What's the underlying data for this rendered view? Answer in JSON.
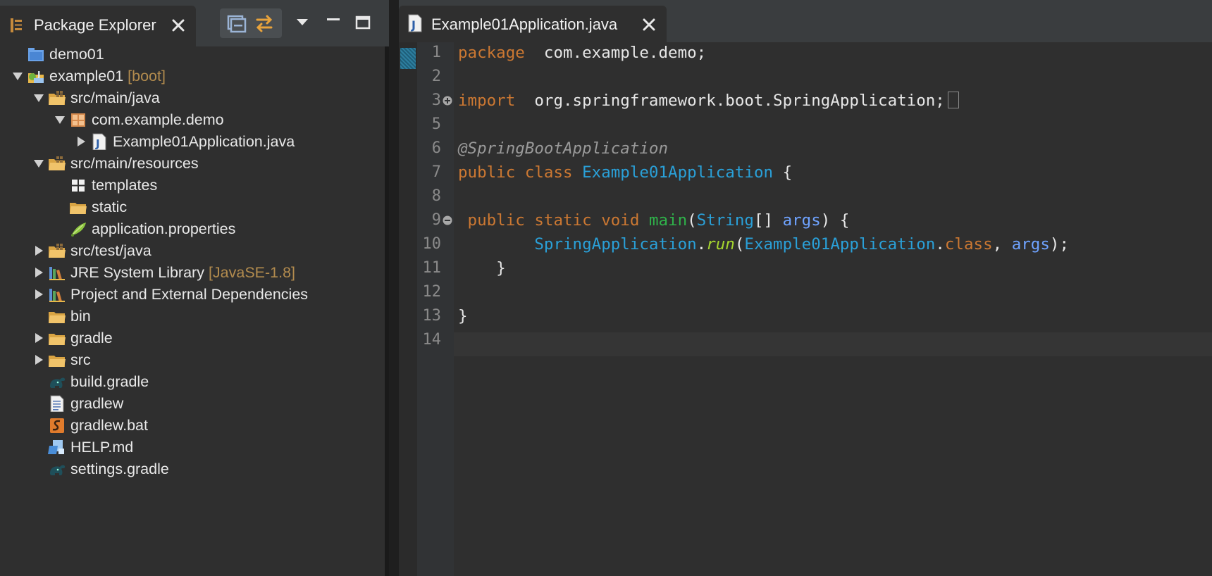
{
  "explorer": {
    "title": "Package Explorer",
    "toolbar": {
      "collapse_all": "collapse-all-icon",
      "link_editor": "link-with-editor-icon",
      "view_menu": "view-menu-icon",
      "minimize": "minimize-icon",
      "maximize": "maximize-icon"
    },
    "tree": [
      {
        "label": "demo01",
        "decoration": "",
        "icon": "project-closed-icon",
        "twisty": "none",
        "level": 0
      },
      {
        "label": "example01",
        "decoration": "[boot]",
        "icon": "spring-project-icon",
        "twisty": "expanded",
        "level": 0
      },
      {
        "label": "src/main/java",
        "decoration": "",
        "icon": "source-folder-icon",
        "twisty": "expanded",
        "level": 1
      },
      {
        "label": "com.example.demo",
        "decoration": "",
        "icon": "package-icon",
        "twisty": "expanded",
        "level": 2
      },
      {
        "label": "Example01Application.java",
        "decoration": "",
        "icon": "java-file-icon",
        "twisty": "collapsed",
        "level": 3
      },
      {
        "label": "src/main/resources",
        "decoration": "",
        "icon": "source-folder-icon",
        "twisty": "expanded",
        "level": 1
      },
      {
        "label": "templates",
        "decoration": "",
        "icon": "empty-package-icon",
        "twisty": "none",
        "level": 2
      },
      {
        "label": "static",
        "decoration": "",
        "icon": "folder-icon",
        "twisty": "none",
        "level": 2
      },
      {
        "label": "application.properties",
        "decoration": "",
        "icon": "properties-file-icon",
        "twisty": "none",
        "level": 2
      },
      {
        "label": "src/test/java",
        "decoration": "",
        "icon": "source-folder-icon",
        "twisty": "collapsed",
        "level": 1
      },
      {
        "label": "JRE System Library",
        "decoration": "[JavaSE-1.8]",
        "icon": "library-icon",
        "twisty": "collapsed",
        "level": 1
      },
      {
        "label": "Project and External Dependencies",
        "decoration": "",
        "icon": "library-icon",
        "twisty": "collapsed",
        "level": 1
      },
      {
        "label": "bin",
        "decoration": "",
        "icon": "folder-icon",
        "twisty": "none",
        "level": 1
      },
      {
        "label": "gradle",
        "decoration": "",
        "icon": "folder-icon",
        "twisty": "collapsed",
        "level": 1
      },
      {
        "label": "src",
        "decoration": "",
        "icon": "folder-icon",
        "twisty": "collapsed",
        "level": 1
      },
      {
        "label": "build.gradle",
        "decoration": "",
        "icon": "gradle-file-icon",
        "twisty": "none",
        "level": 1
      },
      {
        "label": "gradlew",
        "decoration": "",
        "icon": "text-file-icon",
        "twisty": "none",
        "level": 1
      },
      {
        "label": "gradlew.bat",
        "decoration": "",
        "icon": "script-file-icon",
        "twisty": "none",
        "level": 1
      },
      {
        "label": "HELP.md",
        "decoration": "",
        "icon": "markdown-file-icon",
        "twisty": "none",
        "level": 1
      },
      {
        "label": "settings.gradle",
        "decoration": "",
        "icon": "gradle-file-icon",
        "twisty": "none",
        "level": 1
      }
    ]
  },
  "editor": {
    "tab_title": "Example01Application.java",
    "current_line": 14,
    "lines": [
      {
        "n": "1",
        "fold": "",
        "tokens": [
          [
            "kw",
            "package"
          ],
          [
            "",
            "  com.example.demo;"
          ]
        ]
      },
      {
        "n": "2",
        "fold": "",
        "tokens": []
      },
      {
        "n": "3",
        "fold": "expand",
        "tokens": [
          [
            "kw",
            "import"
          ],
          [
            "",
            "  org.springframework.boot.SpringApplication;"
          ],
          [
            "box",
            ""
          ]
        ]
      },
      {
        "n": "5",
        "fold": "",
        "tokens": []
      },
      {
        "n": "6",
        "fold": "",
        "tokens": [
          [
            "ann",
            "@SpringBootApplication"
          ]
        ]
      },
      {
        "n": "7",
        "fold": "",
        "tokens": [
          [
            "kw",
            "public"
          ],
          [
            "",
            " "
          ],
          [
            "kw",
            "class"
          ],
          [
            "",
            " "
          ],
          [
            "cls",
            "Example01Application"
          ],
          [
            "",
            " {"
          ]
        ]
      },
      {
        "n": "8",
        "fold": "",
        "tokens": []
      },
      {
        "n": "9",
        "fold": "collapse",
        "tokens": [
          [
            "",
            " "
          ],
          [
            "kw",
            "public"
          ],
          [
            "",
            " "
          ],
          [
            "kw",
            "static"
          ],
          [
            "",
            " "
          ],
          [
            "kw",
            "void"
          ],
          [
            "",
            " "
          ],
          [
            "mth",
            "main"
          ],
          [
            "",
            "("
          ],
          [
            "cls",
            "String"
          ],
          [
            "",
            "[] "
          ],
          [
            "par",
            "args"
          ],
          [
            "",
            ") {"
          ]
        ]
      },
      {
        "n": "10",
        "fold": "",
        "tokens": [
          [
            "",
            "        "
          ],
          [
            "cls",
            "SpringApplication"
          ],
          [
            "",
            "."
          ],
          [
            "smth",
            "run"
          ],
          [
            "",
            "("
          ],
          [
            "cls",
            "Example01Application"
          ],
          [
            "",
            "."
          ],
          [
            "fld",
            "class"
          ],
          [
            "",
            ", "
          ],
          [
            "par",
            "args"
          ],
          [
            "",
            ");"
          ]
        ]
      },
      {
        "n": "11",
        "fold": "",
        "tokens": [
          [
            "",
            "    }"
          ]
        ]
      },
      {
        "n": "12",
        "fold": "",
        "tokens": []
      },
      {
        "n": "13",
        "fold": "",
        "tokens": [
          [
            "",
            "}"
          ]
        ]
      },
      {
        "n": "14",
        "fold": "",
        "tokens": []
      }
    ]
  },
  "colors": {
    "keyword": "#cc7832",
    "class": "#2aa0d8",
    "annotation": "#999999",
    "method": "#2fb24a",
    "static_method": "#a6d62e",
    "parameter": "#6fa3ff",
    "decoration": "#b28b4e"
  }
}
